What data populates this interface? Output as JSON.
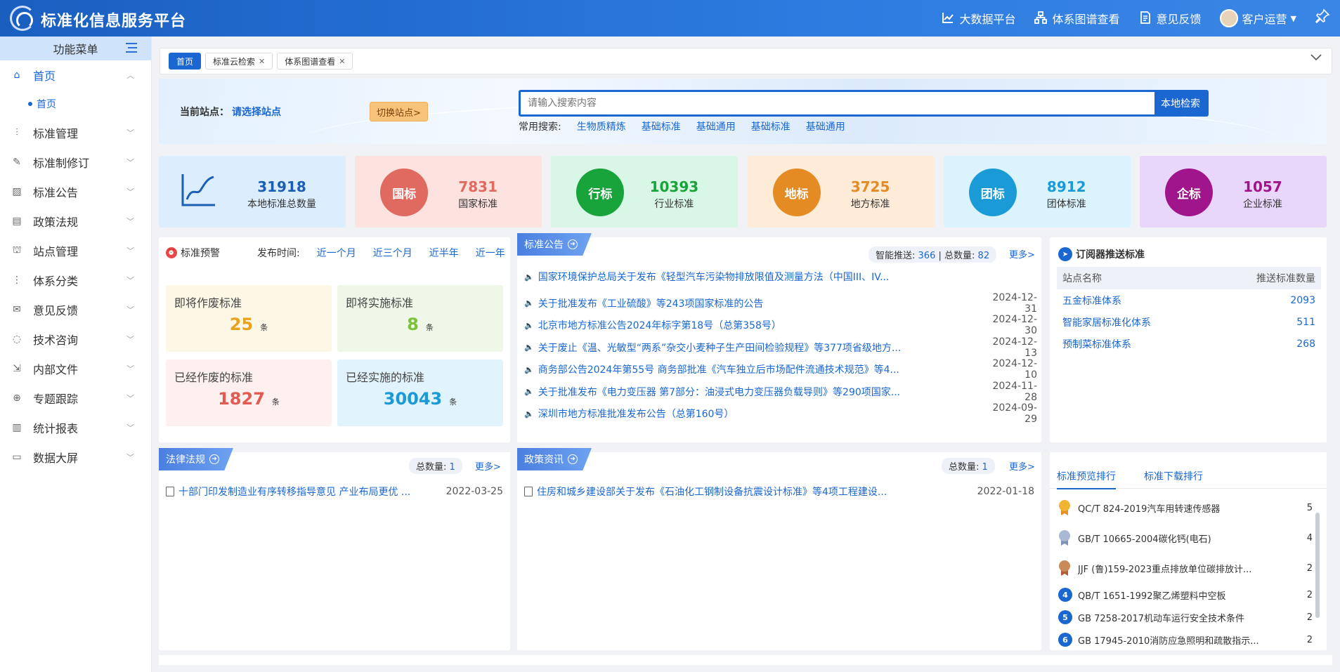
{
  "app": {
    "title": "标准化信息服务平台"
  },
  "topnav": [
    {
      "label": "大数据平台",
      "icon": "chart-line-icon"
    },
    {
      "label": "体系图谱查看",
      "icon": "sitemap-icon"
    },
    {
      "label": "意见反馈",
      "icon": "feedback-icon"
    }
  ],
  "user": {
    "name": "客户运营"
  },
  "sidebar": {
    "header": "功能菜单",
    "items": [
      {
        "label": "首页",
        "icon": "home-icon"
      },
      {
        "label": "标准管理",
        "icon": "sliders-icon"
      },
      {
        "label": "标准制修订",
        "icon": "edit-icon"
      },
      {
        "label": "标准公告",
        "icon": "image-icon"
      },
      {
        "label": "政策法规",
        "icon": "search-doc-icon"
      },
      {
        "label": "站点管理",
        "icon": "network-icon"
      },
      {
        "label": "体系分类",
        "icon": "tree-icon"
      },
      {
        "label": "意见反馈",
        "icon": "inbox-icon"
      },
      {
        "label": "技术咨询",
        "icon": "chat-icon"
      },
      {
        "label": "内部文件",
        "icon": "file-export-icon"
      },
      {
        "label": "专题跟踪",
        "icon": "crosshair-icon"
      },
      {
        "label": "统计报表",
        "icon": "report-icon"
      },
      {
        "label": "数据大屏",
        "icon": "monitor-icon"
      }
    ],
    "sub": "首页"
  },
  "tabs": [
    {
      "label": "首页"
    },
    {
      "label": "标准云检索"
    },
    {
      "label": "体系图谱查看"
    }
  ],
  "banner": {
    "station_label": "当前站点：",
    "station_value": "请选择站点",
    "switch_label": "切换站点>",
    "search_placeholder": "请输入搜索内容",
    "search_button": "本地检索",
    "hot_label": "常用搜索:",
    "hot_words": [
      "生物质精炼",
      "基础标准",
      "基础通用",
      "基础标准",
      "基础通用"
    ]
  },
  "stats": [
    {
      "num": "31918",
      "label": "本地标准总数量",
      "badge": "",
      "color": "#1a5fb4",
      "bg": "#dceefe"
    },
    {
      "num": "7831",
      "label": "国家标准",
      "badge": "国标",
      "color": "#e06a5f",
      "bg": "#fde3df"
    },
    {
      "num": "10393",
      "label": "行业标准",
      "badge": "行标",
      "color": "#19a33b",
      "bg": "#d9f7e6"
    },
    {
      "num": "3725",
      "label": "地方标准",
      "badge": "地标",
      "color": "#e48b23",
      "bg": "#feecd9"
    },
    {
      "num": "8912",
      "label": "团体标准",
      "badge": "团标",
      "color": "#1a9ad6",
      "bg": "#daf3fd"
    },
    {
      "num": "1057",
      "label": "企业标准",
      "badge": "企标",
      "color": "#a0148c",
      "bg": "#e9d6fb"
    }
  ],
  "warning": {
    "title": "标准预警",
    "time_label": "发布时间:",
    "periods": [
      "近一个月",
      "近三个月",
      "近半年",
      "近一年"
    ],
    "boxes": [
      {
        "title": "即将作废标准",
        "num": "25",
        "unit": "条"
      },
      {
        "title": "即将实施标准",
        "num": "8",
        "unit": "条"
      },
      {
        "title": "已经作废的标准",
        "num": "1827",
        "unit": "条"
      },
      {
        "title": "已经实施的标准",
        "num": "30043",
        "unit": "条"
      }
    ]
  },
  "announcements": {
    "title": "标准公告",
    "smart_label": "智能推送:",
    "smart_value": "366",
    "total_label": "总数量:",
    "total_value": "82",
    "more": "更多>",
    "items": [
      {
        "title": "国家环境保护总局关于发布《轻型汽车污染物排放限值及测量方法（中国III、IV...",
        "date": ""
      },
      {
        "title": "关于批准发布《工业硫酸》等243项国家标准的公告",
        "date": "2024-12-31"
      },
      {
        "title": "北京市地方标准公告2024年标字第18号（总第358号）",
        "date": "2024-12-30"
      },
      {
        "title": "关于废止《温、光敏型“两系”杂交小麦种子生产田间检验规程》等377项省级地方...",
        "date": "2024-12-13"
      },
      {
        "title": "商务部公告2024年第55号 商务部批准《汽车独立后市场配件流通技术规范》等4...",
        "date": "2024-12-10"
      },
      {
        "title": "关于批准发布《电力变压器 第7部分：油浸式电力变压器负载导则》等290项国家...",
        "date": "2024-11-28"
      },
      {
        "title": "深圳市地方标准批准发布公告（总第160号）",
        "date": "2024-09-29"
      }
    ]
  },
  "subscription": {
    "title": "订阅器推送标准",
    "col1": "站点名称",
    "col2": "推送标准数量",
    "rows": [
      {
        "name": "五金标准体系",
        "count": "2093"
      },
      {
        "name": "智能家居标准化体系",
        "count": "511"
      },
      {
        "name": "预制菜标准体系",
        "count": "268"
      }
    ]
  },
  "laws": {
    "title": "法律法规",
    "total_label": "总数量:",
    "total_value": "1",
    "more": "更多>",
    "item": {
      "title": "十部门印发制造业有序转移指导意见 产业布局更优 ...",
      "date": "2022-03-25"
    }
  },
  "policy": {
    "title": "政策资讯",
    "total_label": "总数量:",
    "total_value": "1",
    "more": "更多>",
    "item": {
      "title": "住房和城乡建设部关于发布《石油化工钢制设备抗震设计标准》等4项工程建设...",
      "date": "2022-01-18"
    }
  },
  "ranking": {
    "tabs": [
      "标准预览排行",
      "标准下载排行"
    ],
    "items": [
      {
        "rank": "1",
        "name": "QC/T 824-2019汽车用转速传感器",
        "count": "5"
      },
      {
        "rank": "2",
        "name": "GB/T 10665-2004碳化钙(电石)",
        "count": "4"
      },
      {
        "rank": "3",
        "name": "JJF (鲁)159-2023重点排放单位碳排放计...",
        "count": "2"
      },
      {
        "rank": "4",
        "name": "QB/T 1651-1992聚乙烯塑料中空板",
        "count": "2"
      },
      {
        "rank": "5",
        "name": "GB 7258-2017机动车运行安全技术条件",
        "count": "2"
      },
      {
        "rank": "6",
        "name": "GB 17945-2010消防应急照明和疏散指示...",
        "count": "2"
      }
    ]
  }
}
